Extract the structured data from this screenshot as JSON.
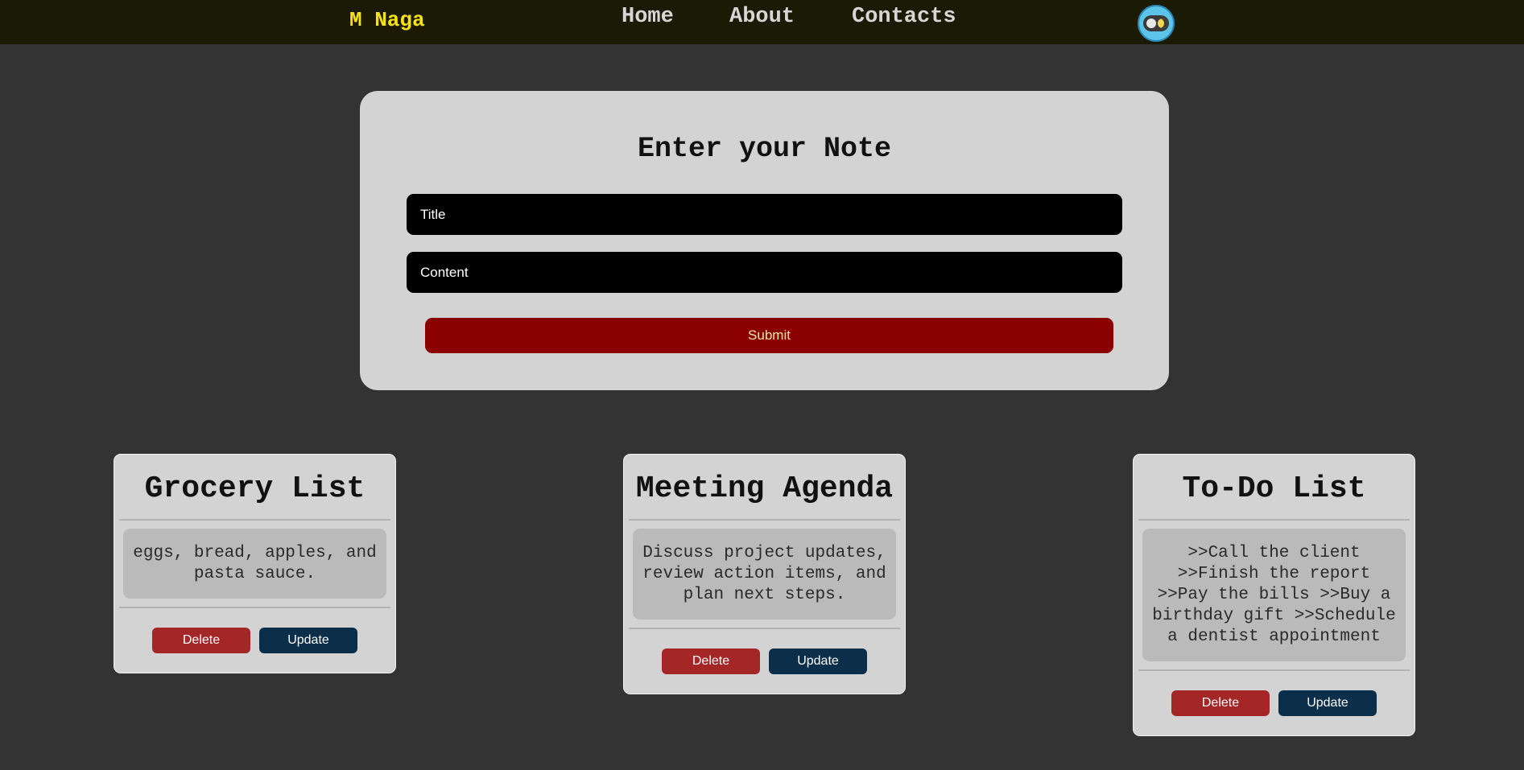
{
  "nav": {
    "brand": "M Naga",
    "links": [
      "Home",
      "About",
      "Contacts"
    ],
    "theme_toggle_icon": "dark-mode-toggle-icon"
  },
  "form": {
    "heading": "Enter your Note",
    "title_placeholder": "Title",
    "content_placeholder": "Content",
    "submit_label": "Submit"
  },
  "notes": [
    {
      "title": "Grocery List",
      "content": "eggs, bread, apples, and pasta sauce.",
      "delete_label": "Delete",
      "update_label": "Update"
    },
    {
      "title": "Meeting Agenda",
      "content": "Discuss project updates, review action items, and plan next steps.",
      "delete_label": "Delete",
      "update_label": "Update"
    },
    {
      "title": "To-Do List",
      "content": ">>Call the client >>Finish the report >>Pay the bills >>Buy a birthday gift >>Schedule a dentist appointment",
      "delete_label": "Delete",
      "update_label": "Update"
    }
  ],
  "colors": {
    "background": "#333333",
    "navbar": "#1b1a05",
    "brand": "#f5e216",
    "card": "#d3d3d3",
    "submit": "#8b0000",
    "delete": "#a52626",
    "update": "#0b2e4a"
  }
}
